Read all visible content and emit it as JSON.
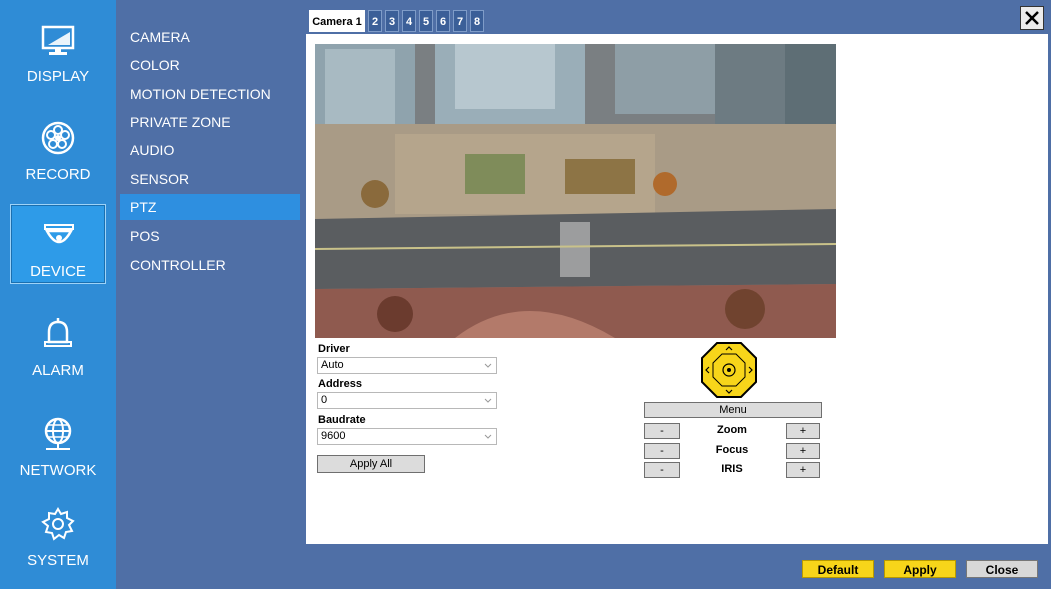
{
  "nav": {
    "items": [
      {
        "label": "DISPLAY",
        "icon": "monitor-icon"
      },
      {
        "label": "RECORD",
        "icon": "reel-icon"
      },
      {
        "label": "DEVICE",
        "icon": "dome-camera-icon",
        "active": true
      },
      {
        "label": "ALARM",
        "icon": "bell-icon"
      },
      {
        "label": "NETWORK",
        "icon": "globe-icon"
      },
      {
        "label": "SYSTEM",
        "icon": "gear-icon"
      }
    ]
  },
  "submenu": {
    "items": [
      "CAMERA",
      "COLOR",
      "MOTION DETECTION",
      "PRIVATE ZONE",
      "AUDIO",
      "SENSOR",
      "PTZ",
      "POS",
      "CONTROLLER"
    ],
    "active": "PTZ"
  },
  "tabs": [
    "Camera 1",
    "2",
    "3",
    "4",
    "5",
    "6",
    "7",
    "8"
  ],
  "form": {
    "driver": {
      "label": "Driver",
      "value": "Auto"
    },
    "address": {
      "label": "Address",
      "value": "0"
    },
    "baudrate": {
      "label": "Baudrate",
      "value": "9600"
    },
    "apply_all": "Apply All"
  },
  "ptz": {
    "menu": "Menu",
    "rows": [
      {
        "label": "Zoom",
        "minus": "-",
        "plus": "+"
      },
      {
        "label": "Focus",
        "minus": "-",
        "plus": "+"
      },
      {
        "label": "IRIS",
        "minus": "-",
        "plus": "+"
      }
    ]
  },
  "footer": {
    "default": "Default",
    "apply": "Apply",
    "close": "Close"
  },
  "colors": {
    "nav_bg": "#2f8cd6",
    "panel_bg": "#4f6fa6",
    "active_sub": "#2e8fe0",
    "yellow": "#f7d51a"
  }
}
